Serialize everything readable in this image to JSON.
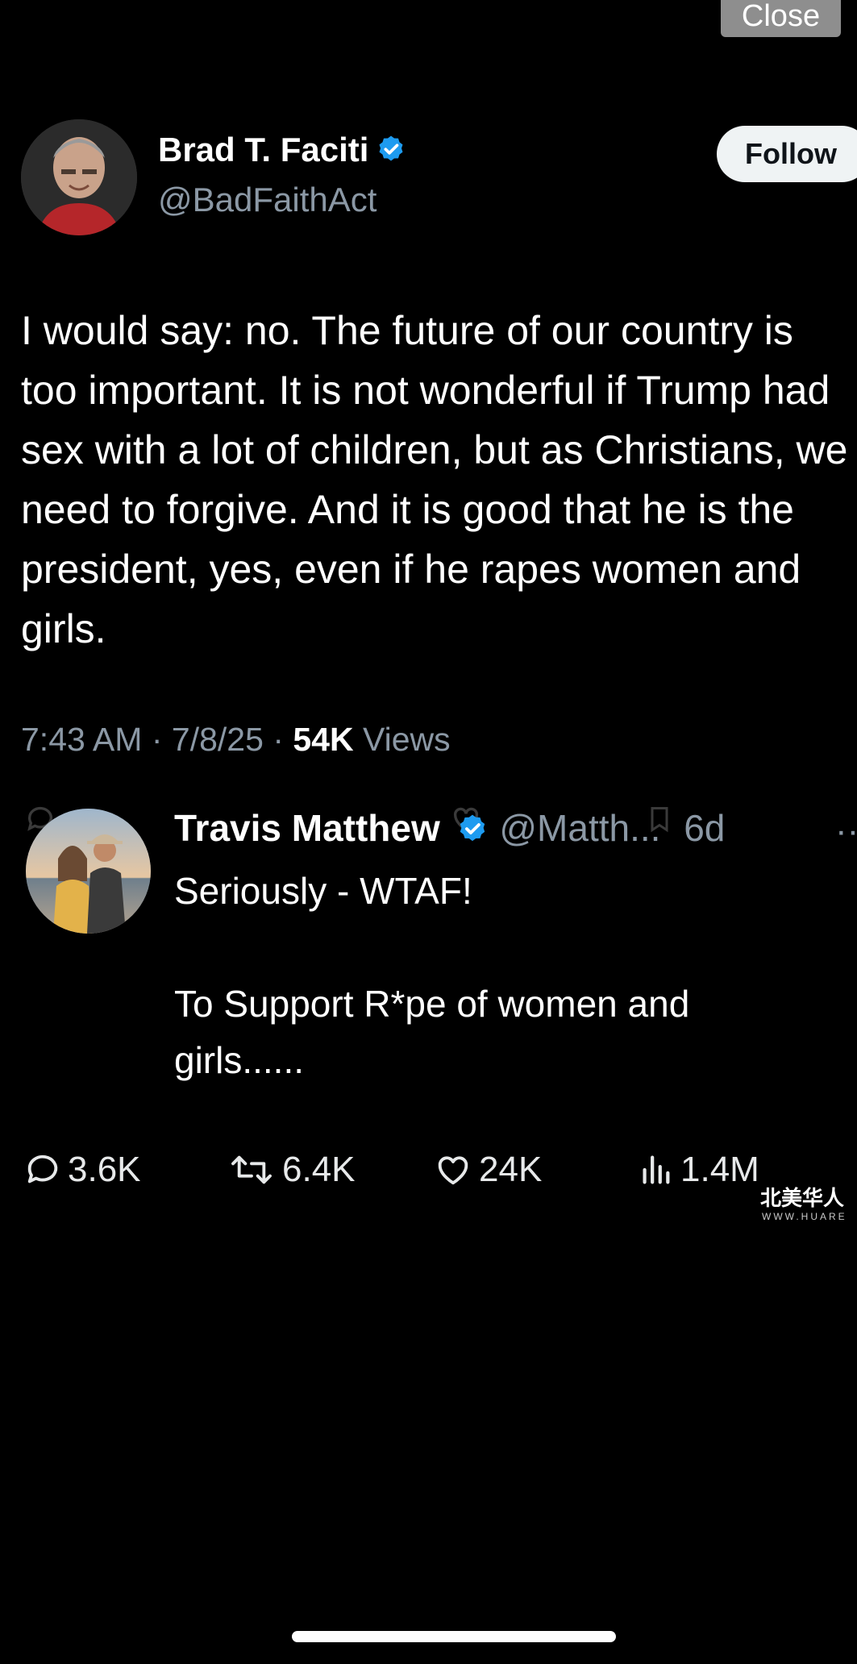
{
  "overlay": {
    "close_label": "Close"
  },
  "tweet": {
    "author_name": "Brad T. Faciti",
    "author_handle": "@BadFaithAct",
    "follow_label": "Follow",
    "text": "I would say: no. The future of our country is too important. It is not wonderful if Trump had sex with a lot of children, but as Christians, we need to forgive. And it is good that he is the president, yes, even if he rapes women and girls.",
    "time": "7:43 AM",
    "date": "7/8/25",
    "views_count": "54K",
    "views_label": "Views",
    "separator": "·"
  },
  "reply": {
    "author_name": "Travis Matthew",
    "author_handle": "@Matth...",
    "time_ago": "6d",
    "line1": "Seriously - WTAF!",
    "line2": "To Support R*pe of women and",
    "line3": "girls......",
    "more_icon": "···"
  },
  "actions": {
    "replies": "3.6K",
    "reposts": "6.4K",
    "likes": "24K",
    "views": "1.4M"
  },
  "watermark": {
    "text": "北美华人",
    "sub": "WWW.HUARE"
  },
  "colors": {
    "background": "#000000",
    "text": "#e7e9ea",
    "muted": "#8b98a5",
    "verified": "#1d9bf0",
    "follow_bg": "#eff3f4"
  }
}
